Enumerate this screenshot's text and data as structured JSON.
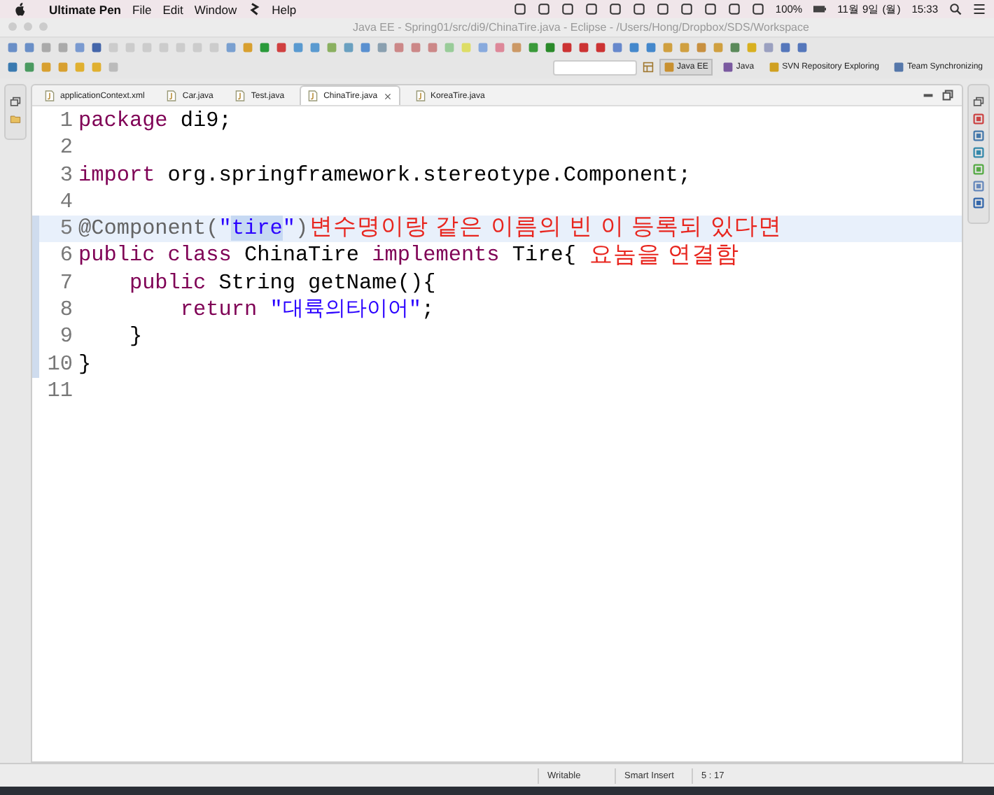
{
  "menubar": {
    "app_name": "Ultimate Pen",
    "items": [
      "File",
      "Edit",
      "Window",
      "Help"
    ],
    "battery": "100%",
    "date": "11월 9일 (월)",
    "time": "15:33"
  },
  "window": {
    "title": "Java EE - Spring01/src/di9/ChinaTire.java - Eclipse - /Users/Hong/Dropbox/SDS/Workspace"
  },
  "perspectives": [
    {
      "label": "Java EE",
      "selected": true
    },
    {
      "label": "Java",
      "selected": false
    },
    {
      "label": "SVN Repository Exploring",
      "selected": false
    },
    {
      "label": "Team Synchronizing",
      "selected": false
    }
  ],
  "tabs": [
    {
      "label": "applicationContext.xml",
      "selected": false
    },
    {
      "label": "Car.java",
      "selected": false
    },
    {
      "label": "Test.java",
      "selected": false
    },
    {
      "label": "ChinaTire.java",
      "selected": true
    },
    {
      "label": "KoreaTire.java",
      "selected": false
    }
  ],
  "editor": {
    "lines": [
      {
        "number": "1",
        "current": false,
        "tokens": [
          {
            "kind": "keyword",
            "text": "package"
          },
          {
            "kind": "plain",
            "text": " di9;"
          }
        ]
      },
      {
        "number": "2",
        "current": false
      },
      {
        "number": "3",
        "current": false,
        "tokens": [
          {
            "kind": "keyword",
            "text": "import"
          },
          {
            "kind": "plain",
            "text": " org.springframework.stereotype.Component;"
          }
        ]
      },
      {
        "number": "4",
        "current": false
      },
      {
        "number": "5",
        "current": true,
        "tokens": [
          {
            "kind": "annotation",
            "text": "@Component("
          },
          {
            "kind": "string",
            "text": "\""
          },
          {
            "kind": "selection",
            "text": "tire"
          },
          {
            "kind": "string",
            "text": "\""
          },
          {
            "kind": "annotation",
            "text": ")"
          }
        ]
      },
      {
        "number": "6",
        "current": false,
        "tokens": [
          {
            "kind": "keyword",
            "text": "public class"
          },
          {
            "kind": "plain",
            "text": " ChinaTire "
          },
          {
            "kind": "keyword",
            "text": "implements"
          },
          {
            "kind": "plain",
            "text": " Tire{"
          }
        ]
      },
      {
        "number": "7",
        "current": false,
        "tokens": [
          {
            "kind": "keyword",
            "text": "    public"
          },
          {
            "kind": "plain",
            "text": " String getName(){"
          }
        ]
      },
      {
        "number": "8",
        "current": false,
        "tokens": [
          {
            "kind": "keyword",
            "text": "        return "
          },
          {
            "kind": "string",
            "text": "\"대륙의타이어\""
          },
          {
            "kind": "plain",
            "text": ";"
          }
        ]
      },
      {
        "number": "9",
        "current": false,
        "tokens": [
          {
            "kind": "plain",
            "text": "    }"
          }
        ]
      },
      {
        "number": "10",
        "current": false,
        "tokens": [
          {
            "kind": "plain",
            "text": "}"
          }
        ]
      },
      {
        "number": "11",
        "current": false
      }
    ],
    "note": [
      "변수명이랑 같은 이름의 빈 이 등록되 있다면",
      "요놈을 연결함"
    ]
  },
  "status_bar": [
    "Writable",
    "Smart Insert",
    "5 : 17"
  ]
}
